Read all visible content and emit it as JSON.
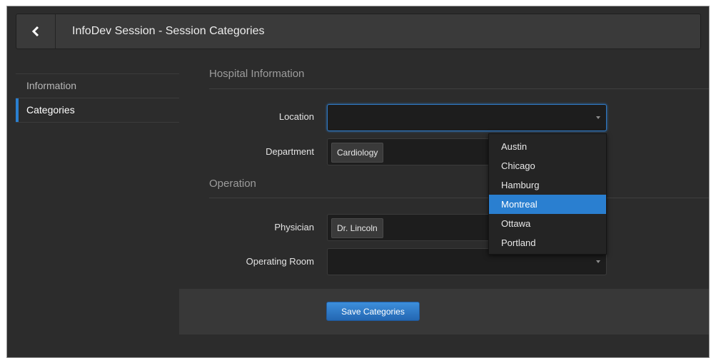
{
  "window": {
    "title": "InfoDev Session - Session Categories"
  },
  "icons": {
    "back": "chevron-left-icon",
    "select_caret": "caret-down-icon"
  },
  "sidebar": {
    "items": [
      {
        "label": "Information",
        "active": false
      },
      {
        "label": "Categories",
        "active": true
      }
    ]
  },
  "sections": {
    "hospital": {
      "title": "Hospital Information",
      "location": {
        "label": "Location",
        "value": ""
      },
      "department": {
        "label": "Department",
        "value": "Cardiology"
      }
    },
    "operation": {
      "title": "Operation",
      "physician": {
        "label": "Physician",
        "value": "Dr. Lincoln"
      },
      "operating_room": {
        "label": "Operating Room",
        "value": ""
      }
    }
  },
  "location_dropdown": {
    "open": true,
    "highlighted": "Montreal",
    "options": [
      "Austin",
      "Chicago",
      "Hamburg",
      "Montreal",
      "Ottawa",
      "Portland"
    ]
  },
  "footer": {
    "save_label": "Save Categories"
  },
  "colors": {
    "accent": "#2a7fd0",
    "background": "#2c2c2c",
    "header": "#3a3a3a"
  }
}
